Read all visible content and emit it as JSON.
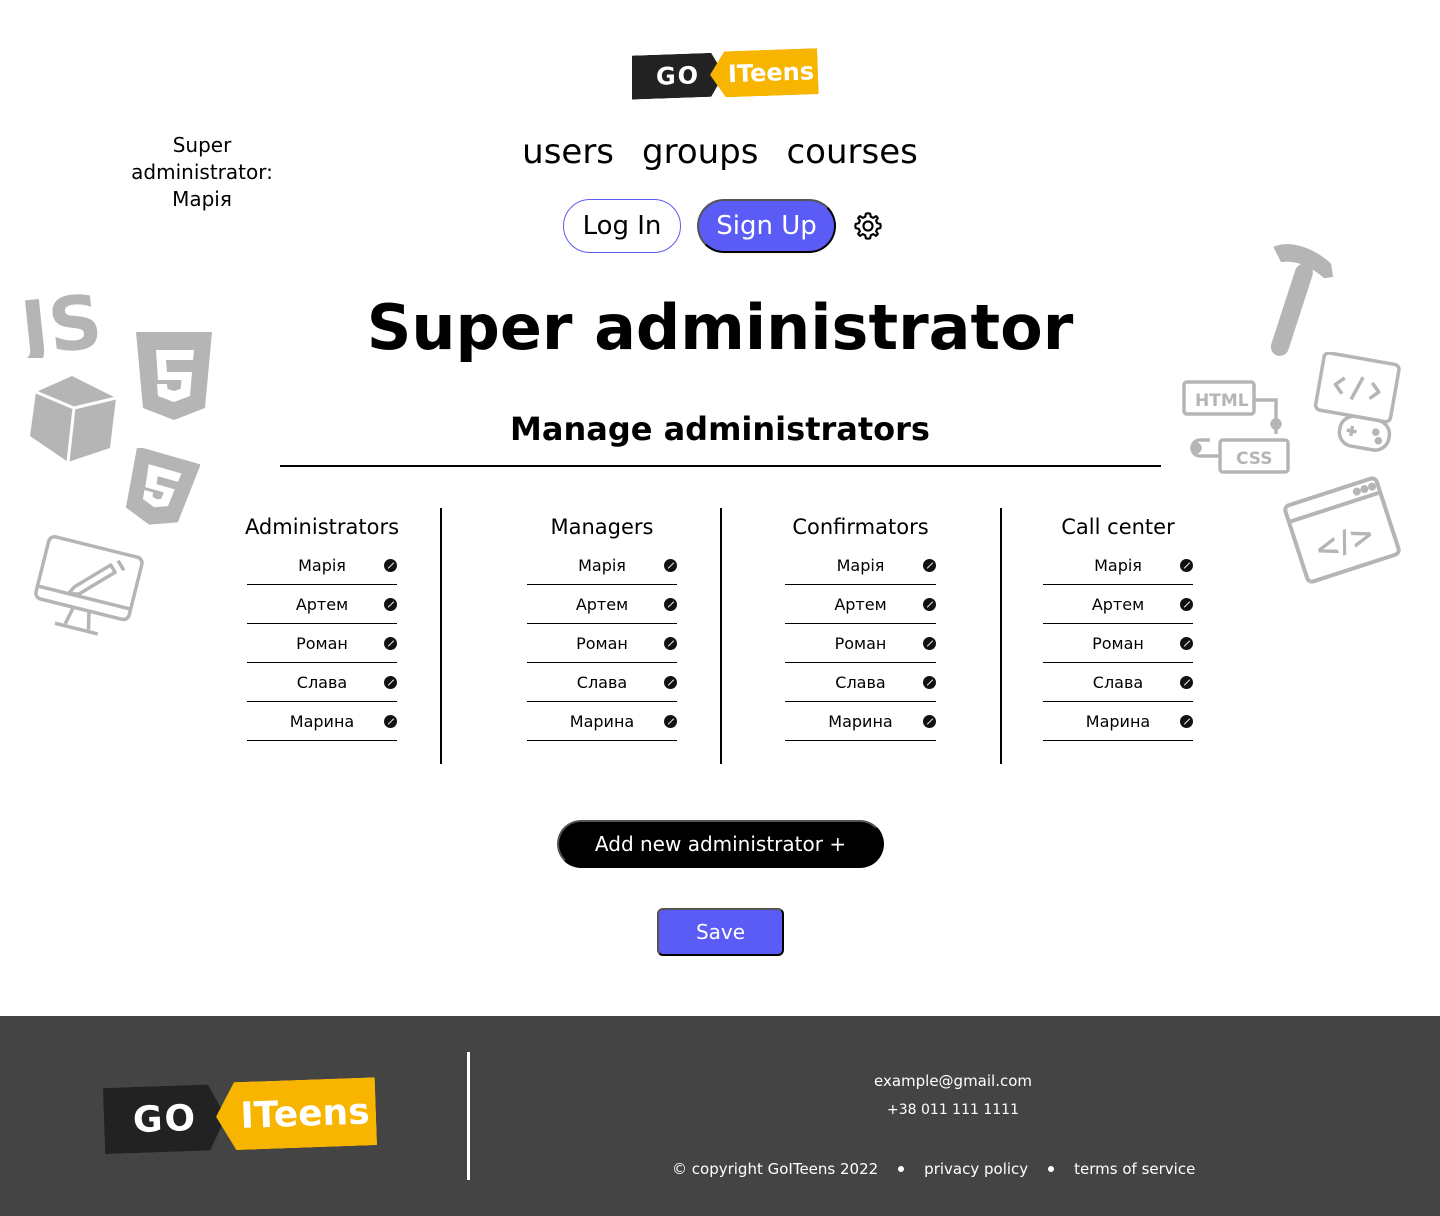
{
  "brand": {
    "part1": "GO",
    "part2": "ITeens",
    "dark_color": "#222222",
    "accent_color": "#f7b500"
  },
  "user_label": "Super administrator: Марія",
  "nav": {
    "items": [
      "users",
      "groups",
      "courses"
    ]
  },
  "auth": {
    "login_label": "Log In",
    "signup_label": "Sign Up",
    "settings_icon": "gear-icon"
  },
  "page_title": "Super administrator",
  "section_title": "Manage administrators",
  "columns": [
    {
      "title": "Administrators",
      "items": [
        "Марія",
        "Артем",
        "Роман",
        "Слава",
        "Марина"
      ]
    },
    {
      "title": "Managers",
      "items": [
        "Марія",
        "Артем",
        "Роман",
        "Слава",
        "Марина"
      ]
    },
    {
      "title": "Confirmators",
      "items": [
        "Марія",
        "Артем",
        "Роман",
        "Слава",
        "Марина"
      ]
    },
    {
      "title": "Call center",
      "items": [
        "Марія",
        "Артем",
        "Роман",
        "Слава",
        "Марина"
      ]
    }
  ],
  "actions": {
    "add_label": "Add new administrator +",
    "save_label": "Save"
  },
  "decorations": {
    "js_text": "JS",
    "html_text": "HTML",
    "css_text": "CSS",
    "code_text": "</>"
  },
  "footer": {
    "email": "example@gmail.com",
    "phone": "+38 011 111 1111",
    "copyright": "© copyright GoITeens 2022",
    "privacy": "privacy policy",
    "terms": "terms of service"
  },
  "colors": {
    "primary": "#5b5bf5",
    "footer_bg": "#444444",
    "icon_gray": "#b5b5b5"
  }
}
